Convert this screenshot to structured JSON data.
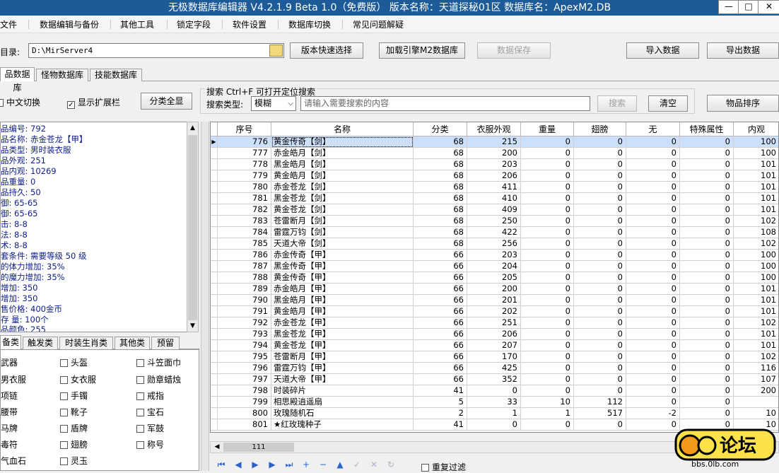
{
  "window": {
    "title": "无极数据库编辑器 V4.2.1.9    Beta 1.0（免费版）    版本名称：天道探秘01区     数据库名：ApexM2.DB",
    "minimize": "—",
    "maximize": "□",
    "close": "✕"
  },
  "menu": [
    "文件",
    "数据编辑与备份",
    "其他工具",
    "锁定字段",
    "软件设置",
    "数据库切换",
    "常见问题解疑"
  ],
  "toolbar": {
    "dir_label": "目录:",
    "dir_value": "D:\\MirServer4",
    "quick_select": "版本快速选择",
    "load_m2": "加载引擎M2数据库",
    "save": "数据保存",
    "import": "导入数据",
    "export": "导出数据"
  },
  "tabs": [
    "品数据库",
    "怪物数据库",
    "技能数据库"
  ],
  "options": {
    "chinese_switch": "中文切换",
    "show_ext": "显示扩展栏",
    "class_all": "分类全显",
    "search_title": "搜索   Ctrl+F 可打开定位搜索",
    "search_type_label": "搜索类型:",
    "search_type_value": "模糊",
    "search_placeholder": "请输入需要搜索的内容",
    "search_btn": "搜索",
    "clear_btn": "清空",
    "sort_btn": "物品排序"
  },
  "info": [
    "品编号: 792",
    "品名称: 赤金苍龙【甲】",
    "品类型: 男时装衣服",
    "品外观: 251",
    "品内观: 10269",
    "品重量: 0",
    "品持久: 50",
    "    御: 65-65",
    "    御: 65-65",
    "    击: 8-8",
    "    法: 8-8",
    "    术: 8-8",
    "套条件: 需要等级 50 级",
    "的体力增加: 35%",
    "的魔力增加: 35%",
    "  增加: 350",
    "  增加: 350",
    "售价格: 400金币",
    "存 量: 100个",
    "品颜色: 255"
  ],
  "class_tabs": [
    "备类",
    "触发类",
    "时装生肖类",
    "其他类",
    "预留"
  ],
  "classes": [
    [
      "武器",
      "头盔",
      "斗笠面巾"
    ],
    [
      "男衣服",
      "女衣服",
      "勋章蜡烛"
    ],
    [
      "项链",
      "手镯",
      "戒指"
    ],
    [
      "腰带",
      "靴子",
      "宝石"
    ],
    [
      "马牌",
      "盾牌",
      "军鼓"
    ],
    [
      "毒符",
      "翅膀",
      "称号"
    ],
    [
      "气血石",
      "灵玉",
      ""
    ]
  ],
  "grid": {
    "headers": [
      "序号",
      "名称",
      "分类",
      "衣服外观",
      "重量",
      "翅膀",
      "无",
      "特殊属性",
      "内观"
    ],
    "rows": [
      [
        "776",
        "黄金传奇【剑】",
        "68",
        "215",
        "0",
        "0",
        "0",
        "0",
        "100"
      ],
      [
        "777",
        "赤金皓月【剑】",
        "68",
        "200",
        "0",
        "0",
        "0",
        "0",
        "100"
      ],
      [
        "778",
        "黑金皓月【剑】",
        "68",
        "203",
        "0",
        "0",
        "0",
        "0",
        "101"
      ],
      [
        "779",
        "黄金皓月【剑】",
        "68",
        "206",
        "0",
        "0",
        "0",
        "0",
        "101"
      ],
      [
        "780",
        "赤金苍龙【剑】",
        "68",
        "411",
        "0",
        "0",
        "0",
        "0",
        "101"
      ],
      [
        "781",
        "黑金苍龙【剑】",
        "68",
        "410",
        "0",
        "0",
        "0",
        "0",
        "101"
      ],
      [
        "782",
        "黄金苍龙【剑】",
        "68",
        "409",
        "0",
        "0",
        "0",
        "0",
        "101"
      ],
      [
        "783",
        "苍雷断月【剑】",
        "68",
        "250",
        "0",
        "0",
        "0",
        "0",
        "102"
      ],
      [
        "784",
        "雷霆万钧【剑】",
        "68",
        "422",
        "0",
        "0",
        "0",
        "0",
        "108"
      ],
      [
        "785",
        "天道大帝【剑】",
        "68",
        "256",
        "0",
        "0",
        "0",
        "0",
        "102"
      ],
      [
        "786",
        "赤金传奇【甲】",
        "66",
        "203",
        "0",
        "0",
        "0",
        "0",
        "100"
      ],
      [
        "787",
        "黑金传奇【甲】",
        "66",
        "204",
        "0",
        "0",
        "0",
        "0",
        "100"
      ],
      [
        "788",
        "黄金传奇【甲】",
        "66",
        "205",
        "0",
        "0",
        "0",
        "0",
        "100"
      ],
      [
        "789",
        "赤金皓月【甲】",
        "66",
        "200",
        "0",
        "0",
        "0",
        "0",
        "101"
      ],
      [
        "790",
        "黑金皓月【甲】",
        "66",
        "201",
        "0",
        "0",
        "0",
        "0",
        "101"
      ],
      [
        "791",
        "黄金皓月【甲】",
        "66",
        "202",
        "0",
        "0",
        "0",
        "0",
        "101"
      ],
      [
        "792",
        "赤金苍龙【甲】",
        "66",
        "251",
        "0",
        "0",
        "0",
        "0",
        "102"
      ],
      [
        "793",
        "黑金苍龙【甲】",
        "66",
        "206",
        "0",
        "0",
        "0",
        "0",
        "101"
      ],
      [
        "794",
        "黄金苍龙【甲】",
        "66",
        "207",
        "0",
        "0",
        "0",
        "0",
        "101"
      ],
      [
        "795",
        "苍雷断月【甲】",
        "66",
        "170",
        "0",
        "0",
        "0",
        "0",
        "102"
      ],
      [
        "796",
        "雷霆万钧【甲】",
        "66",
        "425",
        "0",
        "0",
        "0",
        "0",
        "116"
      ],
      [
        "797",
        "天道大帝【甲】",
        "66",
        "352",
        "0",
        "0",
        "0",
        "0",
        "107"
      ],
      [
        "798",
        "时装碎片",
        "41",
        "0",
        "0",
        "0",
        "0",
        "0",
        "200"
      ],
      [
        "799",
        "相思殿逍遥扇",
        "5",
        "33",
        "10",
        "112",
        "0",
        "0",
        ""
      ],
      [
        "800",
        "玫瑰随机石",
        "2",
        "1",
        "1",
        "517",
        "-2",
        "0",
        "10"
      ],
      [
        "801",
        "★红玫瑰种子",
        "41",
        "0",
        "0",
        "0",
        "0",
        "0",
        "10"
      ]
    ]
  },
  "nav_icons": [
    "⏮",
    "◀",
    "▶",
    "▶",
    "⏭",
    "+",
    "−",
    "▲",
    "✓",
    "✕",
    "↻"
  ],
  "filter_label": "重复过滤",
  "scroll_value": "111",
  "watermark": "bbs.0lb.com",
  "watermark_logo": "论坛",
  "colors": {
    "titlebar": "#1d5a98",
    "info_text": "#0c1d8a",
    "selection": "#cde0fb"
  }
}
